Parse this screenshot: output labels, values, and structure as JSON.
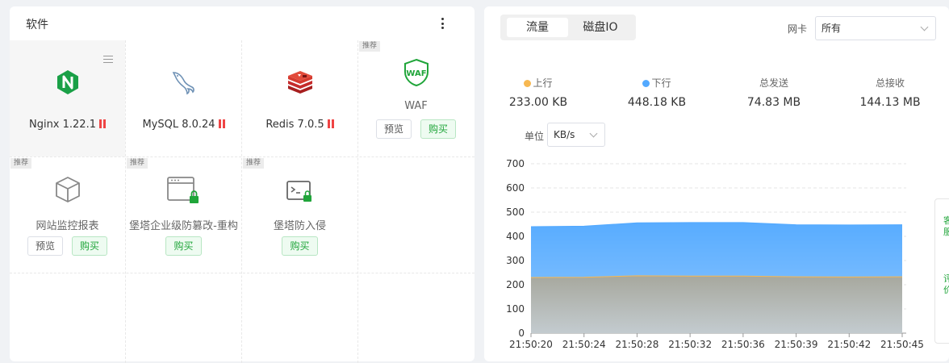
{
  "software": {
    "title": "软件",
    "recommend_tag": "推荐",
    "preview_label": "预览",
    "buy_label": "购买",
    "installed": [
      {
        "name": "Nginx 1.22.1",
        "icon": "nginx-icon"
      },
      {
        "name": "MySQL 8.0.24",
        "icon": "mysql-dolphin-icon"
      },
      {
        "name": "Redis 7.0.5",
        "icon": "redis-icon"
      }
    ],
    "recommended": [
      {
        "name": "WAF",
        "icon": "waf-shield-icon"
      },
      {
        "name": "网站监控报表",
        "icon": "cube-icon"
      },
      {
        "name": "堡塔企业级防篡改-重构",
        "icon": "locked-window-icon"
      },
      {
        "name": "堡塔防入侵",
        "icon": "locked-terminal-icon"
      }
    ]
  },
  "traffic": {
    "tabs": [
      "流量",
      "磁盘IO"
    ],
    "active_tab": "流量",
    "nic_label": "网卡",
    "nic_value": "所有",
    "stats": [
      {
        "label": "上行",
        "value": "233.00 KB",
        "color": "#f7b851"
      },
      {
        "label": "下行",
        "value": "448.18 KB",
        "color": "#52a9ff"
      },
      {
        "label": "总发送",
        "value": "74.83 MB"
      },
      {
        "label": "总接收",
        "value": "144.13 MB"
      }
    ],
    "unit_label": "单位",
    "unit_value": "KB/s"
  },
  "side_float": {
    "line1": "客服",
    "line2": "评价"
  },
  "chart_data": {
    "type": "area",
    "x": [
      "21:50:20",
      "21:50:24",
      "21:50:28",
      "21:50:32",
      "21:50:36",
      "21:50:39",
      "21:50:42",
      "21:50:45"
    ],
    "series": [
      {
        "name": "上行",
        "color": "#f7b851",
        "values": [
          230,
          231,
          237,
          236,
          236,
          233,
          232,
          233
        ]
      },
      {
        "name": "下行",
        "color": "#52a9ff",
        "values": [
          440,
          442,
          456,
          457,
          457,
          448,
          447,
          448
        ]
      }
    ],
    "y_ticks": [
      0,
      100,
      200,
      300,
      400,
      500,
      600,
      700
    ],
    "ylim": [
      0,
      700
    ],
    "grid": true
  }
}
